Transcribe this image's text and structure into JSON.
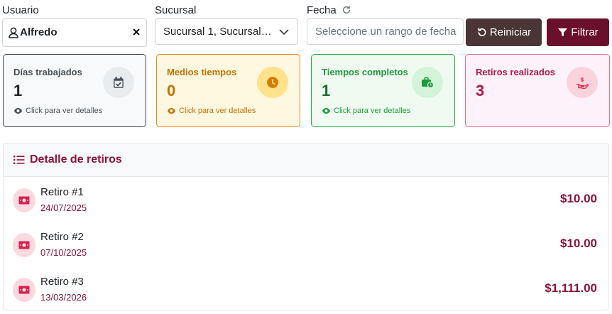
{
  "filters": {
    "user_label": "Usuario",
    "user_value": "Alfredo",
    "branch_label": "Sucursal",
    "branch_value": "Sucursal 1, Sucursal…",
    "date_label": "Fecha",
    "date_placeholder": "Seleccione un rango de fecha",
    "reset_label": "Reiniciar",
    "filter_label": "Filtrar"
  },
  "cards": [
    {
      "title": "Días trabajados",
      "value": "1",
      "link": "Click para ver detalles",
      "icon": "calendar-check-icon"
    },
    {
      "title": "Medios tiempos",
      "value": "0",
      "link": "Click para ver detalles",
      "icon": "clock-icon"
    },
    {
      "title": "Tiempos completos",
      "value": "1",
      "link": "Click para ver detalles",
      "icon": "briefcase-clock-icon"
    },
    {
      "title": "Retiros realizados",
      "value": "3",
      "icon": "hand-dollar-icon"
    }
  ],
  "retiros": {
    "title": "Detalle de retiros",
    "items": [
      {
        "name": "Retiro #1",
        "date": "24/07/2025",
        "amount": "$10.00"
      },
      {
        "name": "Retiro #2",
        "date": "07/10/2025",
        "amount": "$10.00"
      },
      {
        "name": "Retiro #3",
        "date": "13/03/2026",
        "amount": "$1,111.00"
      }
    ]
  },
  "colors": {
    "brand": "#6a0f2c",
    "reset_button": "#4a3636",
    "amount": "#8a1538"
  }
}
